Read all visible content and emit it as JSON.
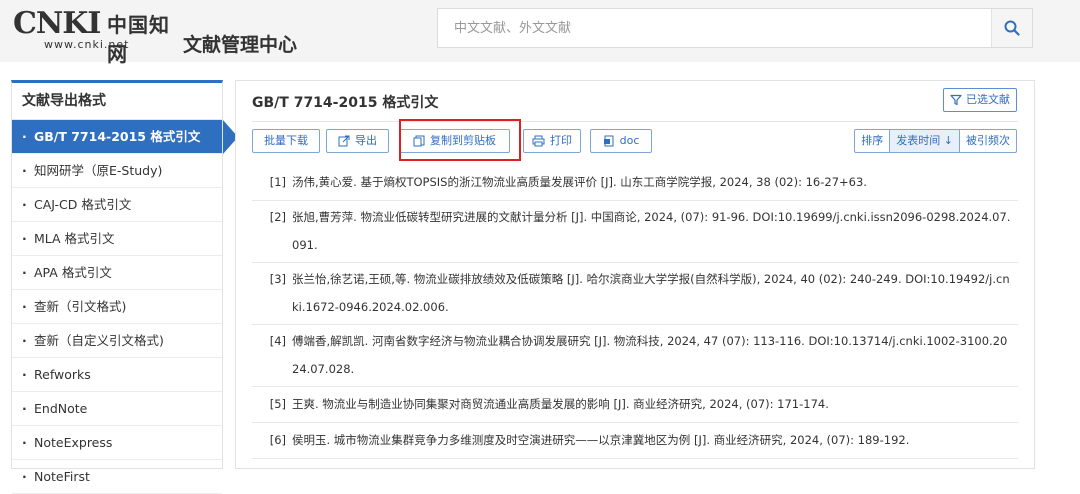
{
  "header": {
    "logo_cnki": "CNKI",
    "logo_chinese": "中国知网",
    "logo_url": "www.cnki.net",
    "app_title": "文献管理中心",
    "search_placeholder": "中文文献、外文文献",
    "search_icon": "search-icon"
  },
  "sidebar": {
    "title": "文献导出格式",
    "items": [
      {
        "label": "GB/T 7714-2015 格式引文",
        "active": true
      },
      {
        "label": "知网研学（原E-Study)"
      },
      {
        "label": "CAJ-CD 格式引文"
      },
      {
        "label": "MLA 格式引文"
      },
      {
        "label": "APA 格式引文"
      },
      {
        "label": "查新（引文格式)"
      },
      {
        "label": "查新（自定义引文格式)"
      },
      {
        "label": "Refworks"
      },
      {
        "label": "EndNote"
      },
      {
        "label": "NoteExpress"
      },
      {
        "label": "NoteFirst"
      }
    ]
  },
  "main": {
    "title": "GB/T 7714-2015 格式引文",
    "selected_button": "已选文献",
    "toolbar": {
      "batch_download": "批量下载",
      "export": "导出",
      "copy_clipboard": "复制到剪贴板",
      "print": "打印",
      "doc": "doc"
    },
    "sort": {
      "label": "排序",
      "by_date": "发表时间",
      "by_citations": "被引频次"
    },
    "references": [
      {
        "num": "[1]",
        "text": "汤伟,黄心爱. 基于熵权TOPSIS的浙江物流业高质量发展评价 [J]. 山东工商学院学报, 2024, 38 (02): 16-27+63."
      },
      {
        "num": "[2]",
        "text": "张旭,曹芳萍. 物流业低碳转型研究进展的文献计量分析 [J]. 中国商论, 2024, (07): 91-96. DOI:10.19699/j.cnki.issn2096-0298.2024.07.091."
      },
      {
        "num": "[3]",
        "text": "张兰怡,徐艺诺,王硕,等. 物流业碳排放绩效及低碳策略 [J]. 哈尔滨商业大学学报(自然科学版), 2024, 40 (02): 240-249. DOI:10.19492/j.cnki.1672-0946.2024.02.006."
      },
      {
        "num": "[4]",
        "text": "傅端香,解凯凯. 河南省数字经济与物流业耦合协调发展研究 [J]. 物流科技, 2024, 47 (07): 113-116. DOI:10.13714/j.cnki.1002-3100.2024.07.028."
      },
      {
        "num": "[5]",
        "text": "王爽. 物流业与制造业协同集聚对商贸流通业高质量发展的影响 [J]. 商业经济研究, 2024, (07): 171-174."
      },
      {
        "num": "[6]",
        "text": "侯明玉. 城市物流业集群竞争力多维测度及时空演进研究——以京津冀地区为例 [J]. 商业经济研究, 2024, (07): 189-192."
      }
    ]
  },
  "colors": {
    "accent": "#2f6fbf",
    "highlight_frame": "#e02020"
  }
}
